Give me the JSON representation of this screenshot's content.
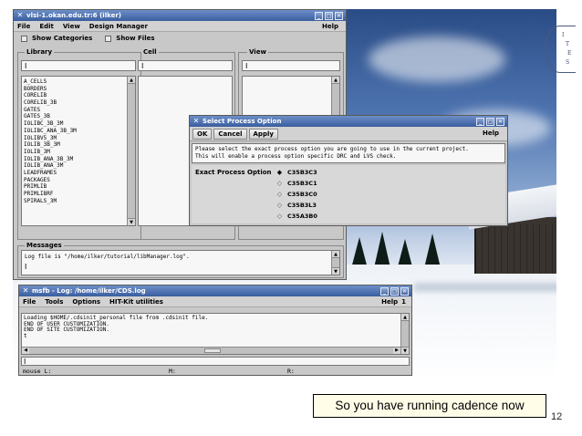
{
  "libmanager": {
    "title": "vlsi-1.okan.edu.tr:6 (ilker)",
    "menu": [
      "File",
      "Edit",
      "View",
      "Design Manager"
    ],
    "help": "Help",
    "show_categories": "Show Categories",
    "show_files": "Show Files",
    "library_label": "Library",
    "cell_label": "Cell",
    "view_label": "View",
    "cursor": "I",
    "libraries": [
      "A_CELLS",
      "BORDERS",
      "CORELIB",
      "CORELIB_3B",
      "GATES",
      "GATES_3B",
      "IOLIBC_3B_3M",
      "IOLIBC_ANA_3B_3M",
      "IOLIBV5_3M",
      "IOLIB_3B_3M",
      "IOLIB_3M",
      "IOLIB_ANA_3B_3M",
      "IOLIB_ANA_3M",
      "LEADFRAMES",
      "PACKAGES",
      "PRIMLIB",
      "PRIMLIBRF",
      "SPIRALS_3M"
    ],
    "messages_label": "Messages",
    "message_text": "Log file is \"/home/ilker/tutorial/libManager.log\"."
  },
  "process_dialog": {
    "title": "Select Process Option",
    "buttons": [
      "OK",
      "Cancel",
      "Apply"
    ],
    "help": "Help",
    "description_line1": "Please select the exact process option you are going to use in the current project.",
    "description_line2": "This will enable a process option specific DRC and LVS check.",
    "option_label": "Exact Process Option",
    "options": [
      "C35B3C3",
      "C35B3C1",
      "C35B3C0",
      "C35B3L3",
      "C35A3B0"
    ],
    "selected": "C35B3C3"
  },
  "log_window": {
    "title": "msfb - Log: /home/ilker/CDS.log",
    "menu": [
      "File",
      "Tools",
      "Options",
      "HIT-Kit utilities"
    ],
    "help": "Help",
    "page": "1",
    "lines": [
      "Loading $HOME/.cdsinit_personal file from .cdsinit file.",
      "END OF USER CUSTOMIZATION.",
      "END OF SITE CUSTOMIZATION.",
      "t"
    ],
    "cursor": "I",
    "mouse_l": "mouse L:",
    "mouse_m": "M:",
    "mouse_r": "R:"
  },
  "caption": "So you have running cadence now",
  "slide_number": "12"
}
